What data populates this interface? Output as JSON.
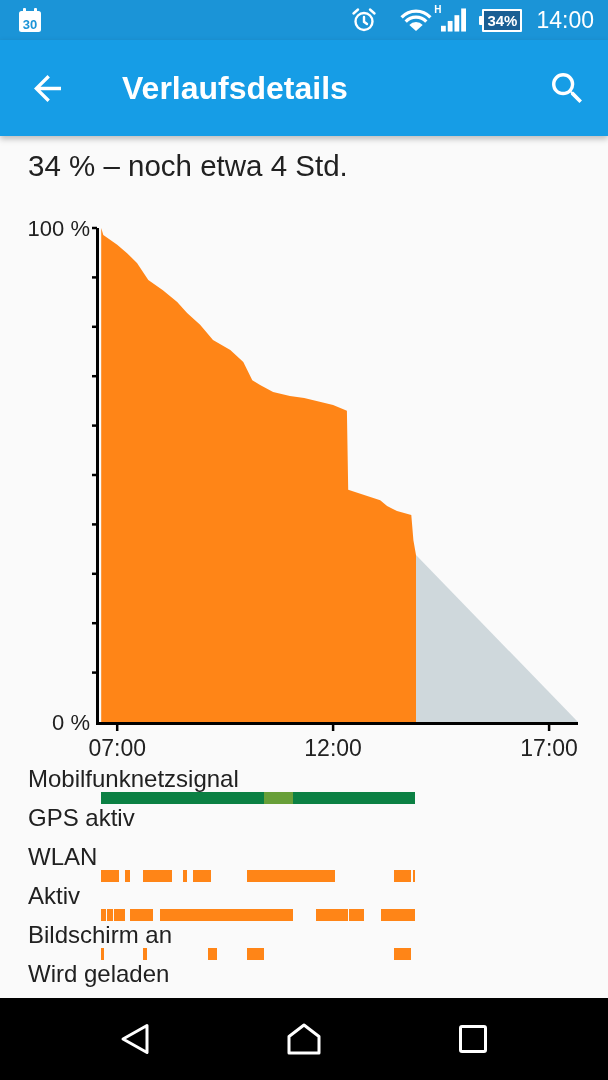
{
  "status_bar": {
    "calendar_date": "30",
    "network_type": "H",
    "battery": "34%",
    "time": "14:00"
  },
  "app_bar": {
    "title": "Verlaufsdetails"
  },
  "summary": "34 % – noch etwa 4 Std.",
  "chart": {
    "chart_data": {
      "type": "area",
      "x": [
        6.63,
        6.68,
        7.0,
        7.23,
        7.46,
        7.72,
        8.06,
        8.39,
        8.62,
        8.92,
        9.22,
        9.62,
        9.92,
        10.13,
        10.31,
        10.61,
        11.0,
        11.33,
        12.0,
        12.32,
        12.35,
        13.09,
        13.25,
        13.48,
        13.81,
        13.86,
        13.92,
        17.67
      ],
      "series": [
        {
          "color": "#ff8517",
          "values": [
            100,
            98.6,
            96.6,
            94.9,
            92.9,
            89.5,
            87.4,
            85.0,
            82.8,
            80.4,
            77.3,
            75.3,
            72.9,
            69.2,
            68.2,
            66.8,
            66.0,
            65.6,
            64.2,
            63.0,
            47.0,
            44.9,
            43.7,
            42.7,
            41.9,
            36.8,
            33.8,
            null
          ]
        },
        {
          "color": "#cfd8dc",
          "values": [
            null,
            null,
            null,
            null,
            null,
            null,
            null,
            null,
            null,
            null,
            null,
            null,
            null,
            null,
            null,
            null,
            null,
            null,
            null,
            null,
            null,
            null,
            null,
            null,
            null,
            null,
            33.8,
            0
          ]
        }
      ],
      "xlim": [
        6.51,
        17.67
      ],
      "ylim": [
        0,
        100
      ],
      "xticks": [
        {
          "value": 7,
          "label": "07:00"
        },
        {
          "value": 12,
          "label": "12:00"
        },
        {
          "value": 17,
          "label": "17:00"
        }
      ],
      "yticks": [
        {
          "value": 0,
          "label": "0 %"
        },
        {
          "value": 100,
          "label": "100 %"
        }
      ]
    }
  },
  "tracks": [
    {
      "label": "Mobilfunknetzsignal"
    },
    {
      "label": "GPS aktiv"
    },
    {
      "label": "WLAN"
    },
    {
      "label": "Aktiv"
    },
    {
      "label": "Bildschirm an"
    },
    {
      "label": "Wird geladen"
    }
  ]
}
